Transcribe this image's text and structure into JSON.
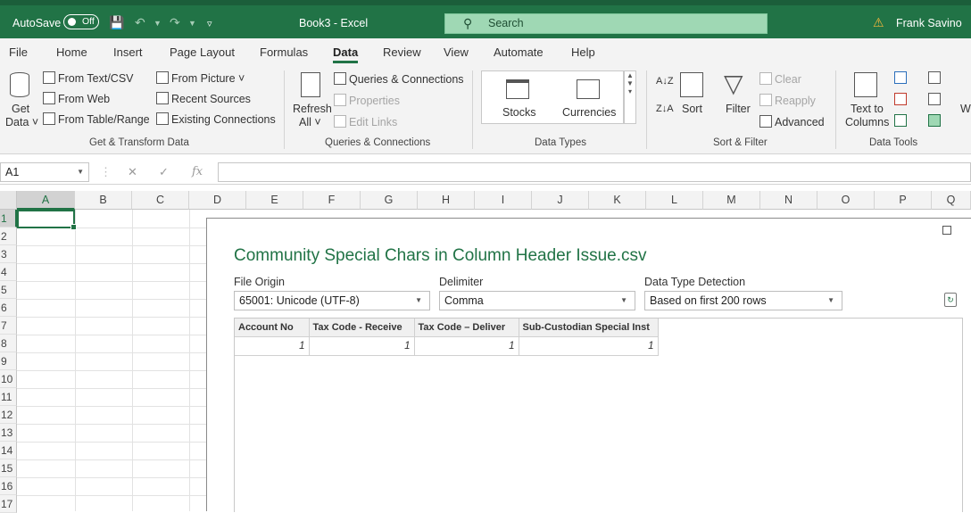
{
  "titlebar": {
    "autosave_label": "AutoSave",
    "autosave_state": "Off",
    "doc_title": "Book3  -  Excel",
    "search_placeholder": "Search",
    "user_name": "Frank Savino"
  },
  "menu": [
    "File",
    "Home",
    "Insert",
    "Page Layout",
    "Formulas",
    "Data",
    "Review",
    "View",
    "Automate",
    "Help"
  ],
  "active_menu": "Data",
  "ribbon": {
    "get_data": [
      "Get",
      "Data ˅"
    ],
    "get_transform": {
      "items": [
        "From Text/CSV",
        "From Web",
        "From Table/Range",
        "From Picture ˅",
        "Recent Sources",
        "Existing Connections"
      ],
      "group": "Get & Transform Data"
    },
    "queries": {
      "refresh": [
        "Refresh",
        "All ˅"
      ],
      "items": [
        "Queries & Connections",
        "Properties",
        "Edit Links"
      ],
      "group": "Queries & Connections"
    },
    "data_types": {
      "items": [
        "Stocks",
        "Currencies"
      ],
      "group": "Data Types"
    },
    "sort_filter": {
      "sort": "Sort",
      "filter": "Filter",
      "items": [
        "Clear",
        "Reapply",
        "Advanced"
      ],
      "group": "Sort & Filter"
    },
    "data_tools": {
      "text_to_columns": [
        "Text to",
        "Columns"
      ],
      "group": "Data Tools",
      "overflow": "W Ar"
    }
  },
  "formula_bar": {
    "name_box": "A1",
    "fx": "fx",
    "value": ""
  },
  "grid": {
    "columns": [
      "A",
      "B",
      "C",
      "D",
      "E",
      "F",
      "G",
      "H",
      "I",
      "J",
      "K",
      "L",
      "M",
      "N",
      "O",
      "P",
      "Q"
    ],
    "rows": [
      "1",
      "2",
      "3",
      "4",
      "5",
      "6",
      "7",
      "8",
      "9",
      "10",
      "11",
      "12",
      "13",
      "14",
      "15",
      "16",
      "17"
    ],
    "active_cell": "A1"
  },
  "dialog": {
    "title": "Community Special Chars in Column Header Issue.csv",
    "file_origin_label": "File Origin",
    "file_origin_value": "65001: Unicode (UTF-8)",
    "delimiter_label": "Delimiter",
    "delimiter_value": "Comma",
    "detection_label": "Data Type Detection",
    "detection_value": "Based on first 200 rows",
    "table": {
      "headers": [
        "Account No",
        "Tax Code - Receive",
        "Tax Code – Deliver",
        "Sub-Custodian Special Inst"
      ],
      "rows": [
        [
          "1",
          "1",
          "1",
          "1"
        ]
      ]
    }
  },
  "colors": {
    "accent": "#217346",
    "title": "#217346",
    "search_bg": "#9fd8b4",
    "warning": "#f6b73c"
  }
}
